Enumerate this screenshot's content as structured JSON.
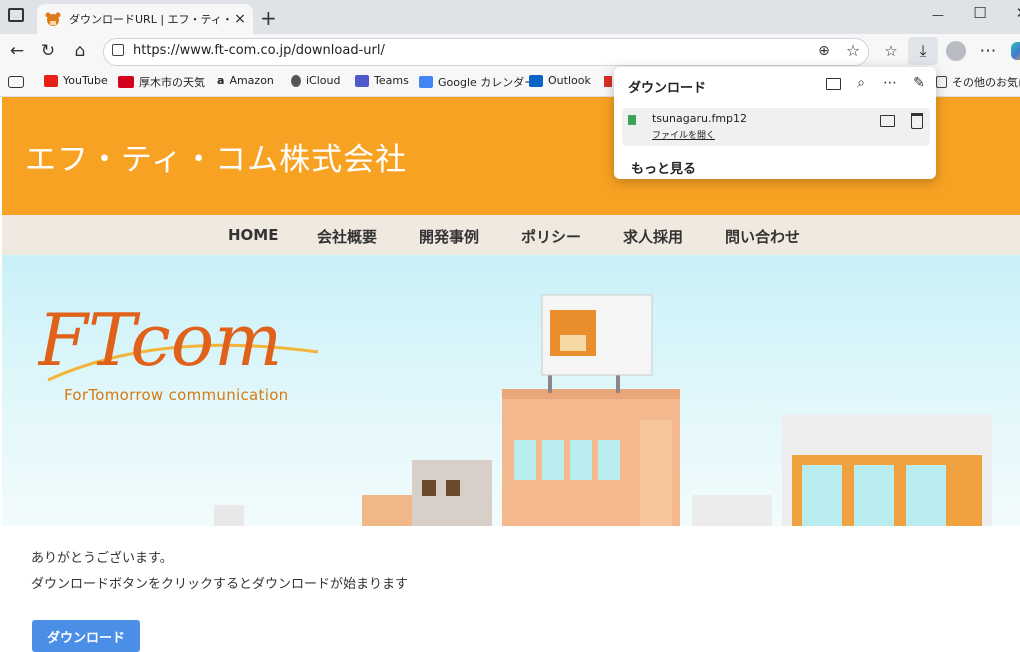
{
  "tab": {
    "title": "ダウンロードURL | エフ・ティ・コム株式会",
    "close": "×",
    "new": "+"
  },
  "window": {
    "minimize": "—",
    "maximize": "☐",
    "close": "✕"
  },
  "nav": {
    "url": "https://www.ft-com.co.jp/download-url/"
  },
  "bookmarks": [
    {
      "label": "YouTube",
      "color": "#e62117"
    },
    {
      "label": "厚木市の天気",
      "color": "#d3001e"
    },
    {
      "label": "Amazon",
      "color": "#222222"
    },
    {
      "label": "iCloud",
      "color": "#555555"
    },
    {
      "label": "Teams",
      "color": "#5059c9"
    },
    {
      "label": "Google カレンダー",
      "color": "#4285f4"
    },
    {
      "label": "Outlook",
      "color": "#0a64c8"
    }
  ],
  "bookmarks_other": "その他のお気に入",
  "site": {
    "company": "エフ・ティ・コム株式会社",
    "menu": [
      "HOME",
      "会社概要",
      "開発事例",
      "ポリシー",
      "求人採用",
      "問い合わせ"
    ],
    "logo_main": "FTcom",
    "logo_tagline": "ForTomorrow communication",
    "thanks": "ありがとうございます。",
    "info": "ダウンロードボタンをクリックするとダウンロードが始まります",
    "button": "ダウンロード"
  },
  "downloads_panel": {
    "title": "ダウンロード",
    "file": "tsunagaru.fmp12",
    "open": "ファイルを開く",
    "more": "もっと見る"
  },
  "colors": {
    "header": "#f8a223",
    "menu_bg": "#efe9df",
    "button": "#4a8ee8"
  }
}
